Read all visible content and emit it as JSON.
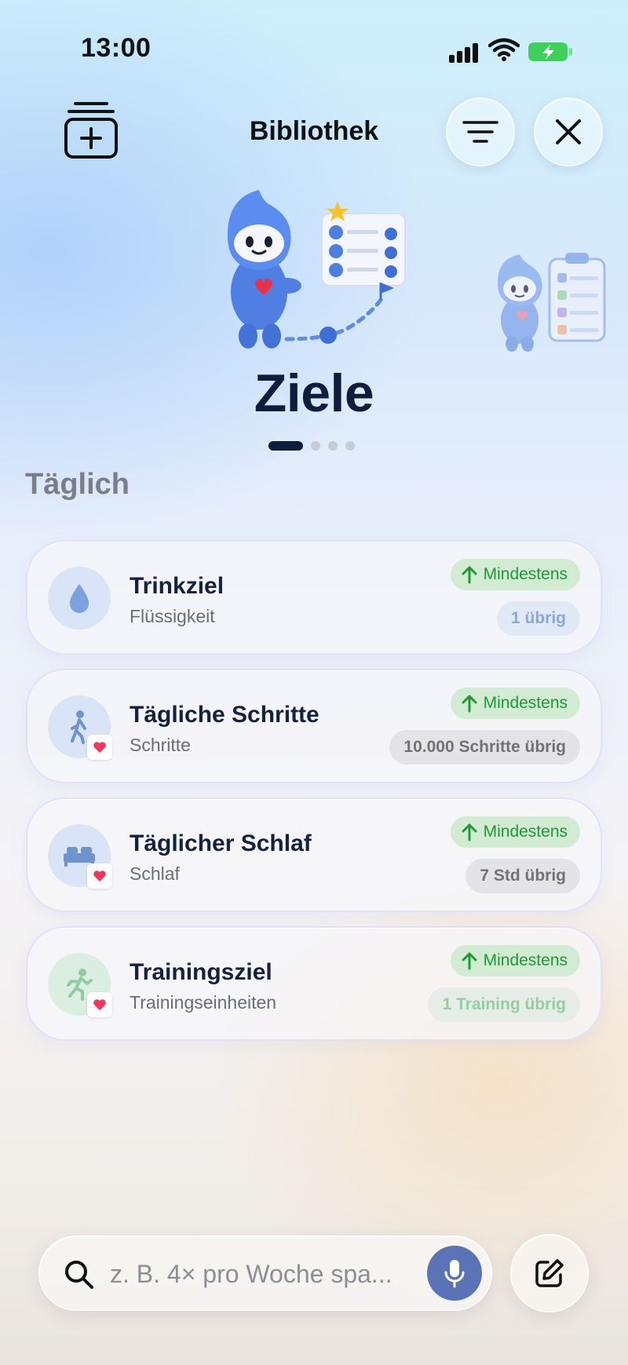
{
  "status_bar": {
    "time": "13:00"
  },
  "header": {
    "title": "Bibliothek"
  },
  "hero": {
    "title": "Ziele",
    "page_count": 4,
    "active_page": 1
  },
  "section": {
    "title": "Täglich"
  },
  "goals": [
    {
      "title": "Trinkziel",
      "subtitle": "Flüssigkeit",
      "direction": "Mindestens",
      "remaining": "1 übrig",
      "icon": "water-drop-icon",
      "health_linked": false,
      "remaining_bg": "#e1e9f6",
      "remaining_color": "#8aa8d8"
    },
    {
      "title": "Tägliche Schritte",
      "subtitle": "Schritte",
      "direction": "Mindestens",
      "remaining": "10.000 Schritte übrig",
      "icon": "walking-icon",
      "health_linked": true,
      "remaining_bg": "#e4e4e7",
      "remaining_color": "#707278"
    },
    {
      "title": "Täglicher Schlaf",
      "subtitle": "Schlaf",
      "direction": "Mindestens",
      "remaining": "7 Std übrig",
      "icon": "bed-icon",
      "health_linked": true,
      "remaining_bg": "#e4e4e7",
      "remaining_color": "#707278"
    },
    {
      "title": "Trainingsziel",
      "subtitle": "Trainingseinheiten",
      "direction": "Mindestens",
      "remaining": "1 Training übrig",
      "icon": "running-icon",
      "health_linked": true,
      "remaining_bg": "#e6ece6",
      "remaining_color": "#96cf9f"
    }
  ],
  "search": {
    "placeholder": "z. B. 4× pro Woche spa..."
  },
  "colors": {
    "accent": "#5a72b6",
    "minimum_green": "#1c9a34",
    "heading": "#0f1d3d"
  }
}
